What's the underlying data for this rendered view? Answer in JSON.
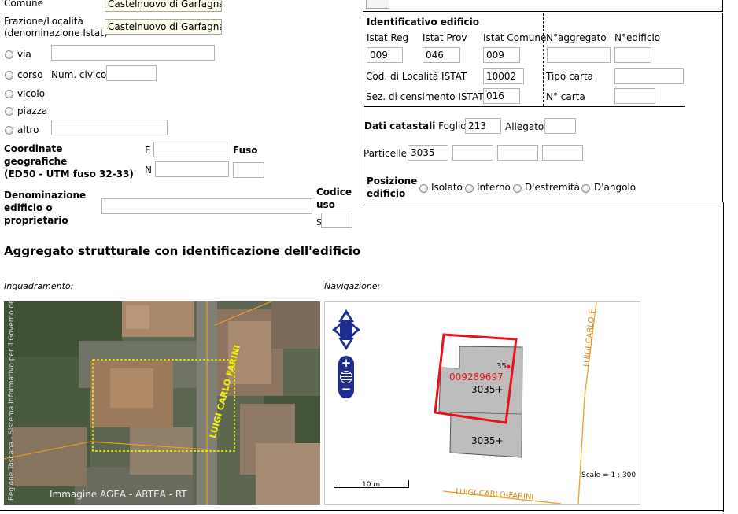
{
  "location": {
    "comune_label": "Comune",
    "comune_value": "Castelnuovo di Garfagnana",
    "frazione_label_1": "Frazione/Località",
    "frazione_label_2": "(denominazione Istat)",
    "frazione_value": "Castelnuovo di Garfagnana",
    "street_types": [
      "via",
      "corso",
      "vicolo",
      "piazza",
      "altro"
    ],
    "num_civico_label": "Num. civico",
    "coord_label_1": "Coordinate",
    "coord_label_2": "geografiche",
    "coord_label_3": "(ED50 - UTM fuso 32-33)",
    "east_label": "E",
    "north_label": "N",
    "fuso_label": "Fuso",
    "denominazione_label_1": "Denominazione",
    "denominazione_label_2": "edificio o",
    "denominazione_label_3": "proprietario",
    "codice_uso_label_1": "Codice",
    "codice_uso_label_2": "uso",
    "codice_uso_prefix": "S"
  },
  "building_id": {
    "title": "Identificativo edificio",
    "istat_reg_label": "Istat Reg",
    "istat_reg_value": "009",
    "istat_prov_label": "Istat Prov",
    "istat_prov_value": "046",
    "istat_comune_label": "Istat Comune",
    "istat_comune_value": "009",
    "n_aggregato_label": "N°aggregato",
    "n_edificio_label": "N°edificio",
    "cod_localita_label": "Cod. di Località ISTAT",
    "cod_localita_value": "10002",
    "tipo_carta_label": "Tipo carta",
    "sez_censimento_label": "Sez. di censimento ISTAT",
    "sez_censimento_value": "016",
    "n_carta_label": "N° carta",
    "catastali_label": "Dati catastali",
    "foglio_label": "Foglio",
    "foglio_value": "213",
    "allegato_label": "Allegato",
    "particelle_label": "Particelle",
    "particelle_values": [
      "3035",
      "",
      "",
      ""
    ],
    "posizione_label_1": "Posizione",
    "posizione_label_2": "edificio",
    "posizione_options": [
      "Isolato",
      "Interno",
      "D'estremità",
      "D'angolo"
    ]
  },
  "section": {
    "title": "Aggregato strutturale con identificazione dell'edificio",
    "inquadramento_label": "Inquadramento:",
    "navigazione_label": "Navigazione:"
  },
  "aerial": {
    "road_label": "LUIGI CARLO FARINI",
    "side_credit": "Regione Toscana - Sistema Informativo per il Governo del Territorio",
    "credit": "Immagine AGEA - ARTEA - RT"
  },
  "map": {
    "building_code": "009289697",
    "parcel_label_top": "3035+",
    "parcel_label_bottom": "3035+",
    "civic_number": "35",
    "road_label_right": "LUIGI-CARLO-F",
    "road_label_bottom": "LUIGI-CARLO-FARINI",
    "scale_bar_label": "10 m",
    "scale_text": "Scale = 1 : 300",
    "nav_icons": [
      "pan-icon",
      "zoom-in-icon",
      "zoom-world-icon",
      "zoom-out-icon"
    ]
  },
  "colors": {
    "nav_blue": "#1e2d8f",
    "highlight_red": "#e3141e",
    "road_orange": "#f0a020",
    "selection_yellow": "#f2f200"
  }
}
